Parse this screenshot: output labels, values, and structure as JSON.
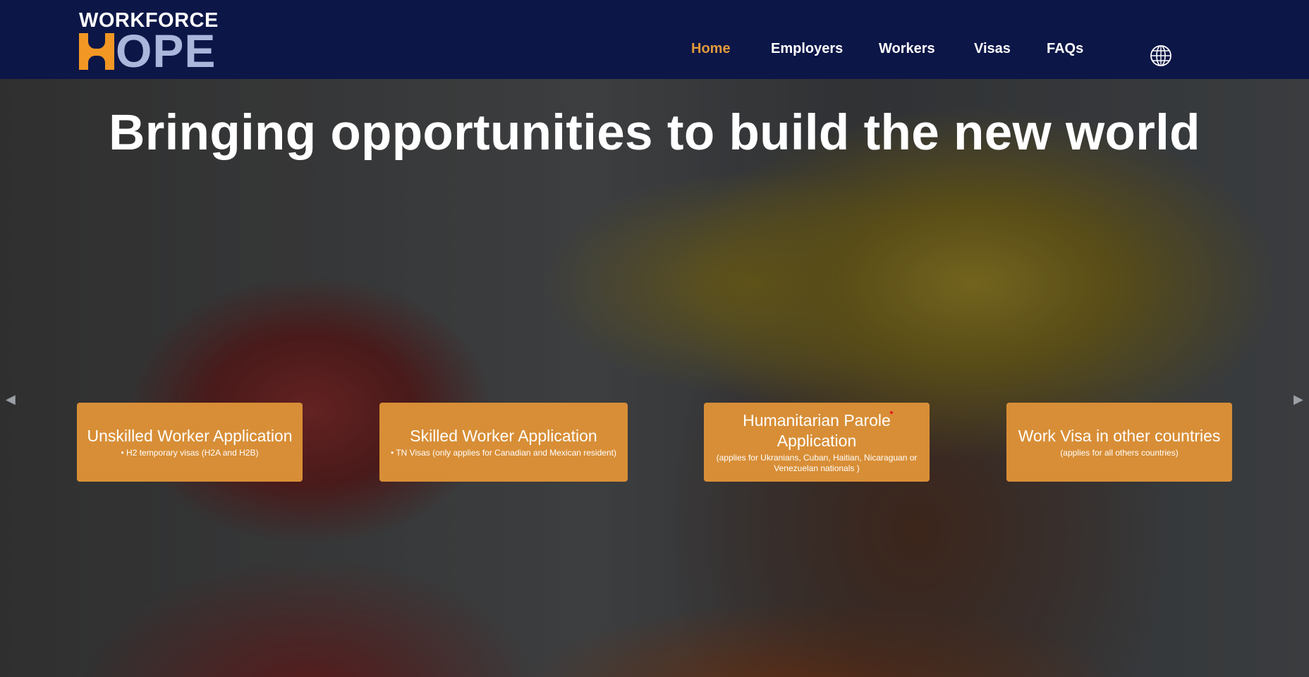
{
  "brand": {
    "top": "WORKFORCE",
    "bottom": "OPE"
  },
  "nav": [
    {
      "label": "Home",
      "active": true
    },
    {
      "label": "Employers"
    },
    {
      "label": "Workers"
    },
    {
      "label": "Visas"
    },
    {
      "label": "FAQs"
    }
  ],
  "hero": {
    "headline": "Bringing opportunities to build the new world"
  },
  "cards": [
    {
      "title": "Unskilled Worker Application",
      "sub": "• H2 temporary visas (H2A and H2B)"
    },
    {
      "title": "Skilled Worker Application",
      "sub": "• TN Visas (only applies for Canadian and Mexican resident)"
    },
    {
      "title": "Humanitarian Parole Application",
      "sub": "(applies for Ukranians, Cuban, Haitian, Nicaraguan or Venezuelan nationals )"
    },
    {
      "title": "Work Visa in other countries",
      "sub": "(applies for all others countries)"
    }
  ],
  "carousel": {
    "prev_icon": "◀",
    "next_icon": "▶"
  },
  "colors": {
    "header": "#0c1647",
    "accent": "#e19a3a",
    "card": "#d88e36"
  }
}
